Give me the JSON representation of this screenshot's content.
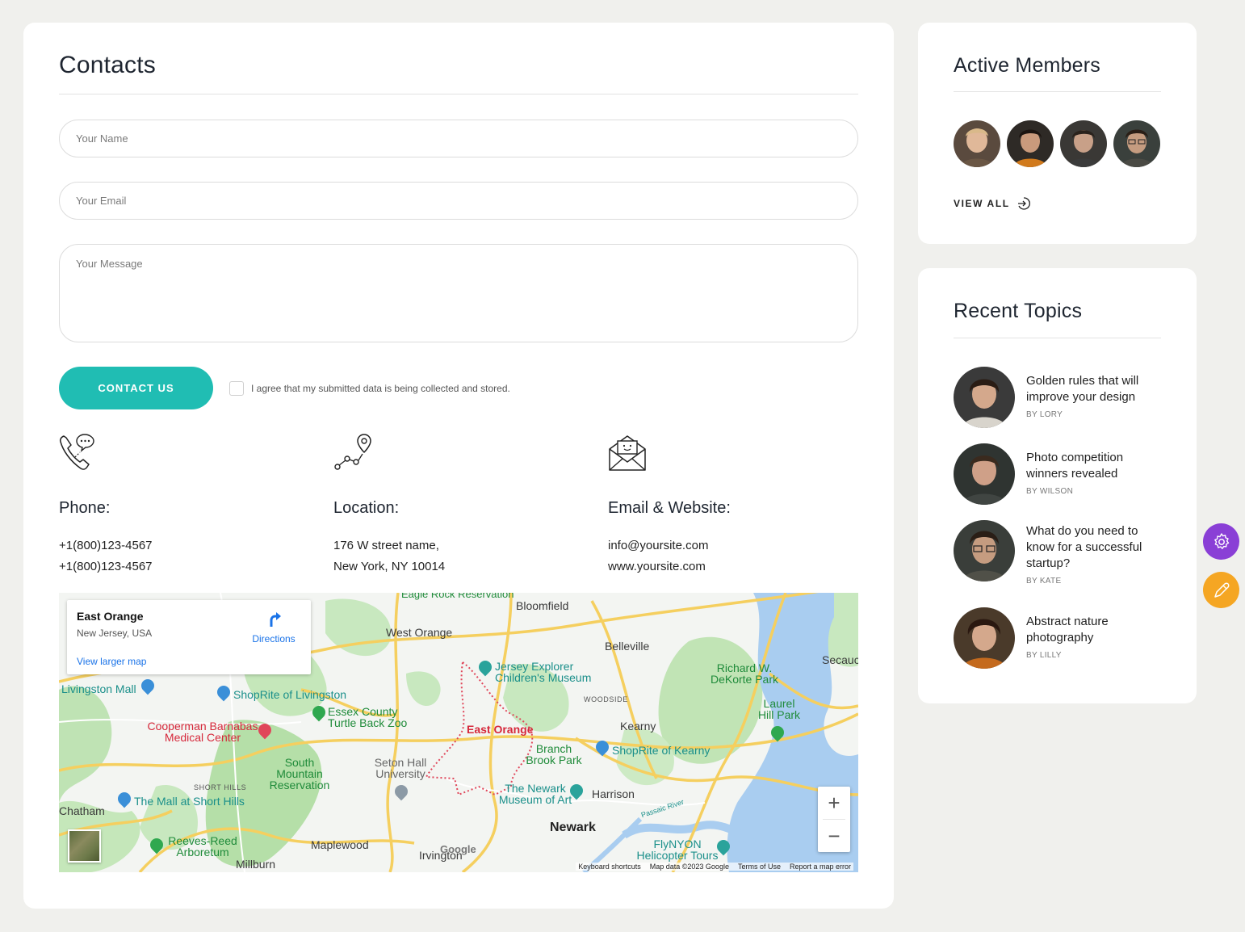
{
  "contacts": {
    "title": "Contacts",
    "form": {
      "name_placeholder": "Your Name",
      "email_placeholder": "Your Email",
      "message_placeholder": "Your Message",
      "submit_label": "CONTACT US",
      "agree_label": "I agree that my submitted data is being collected and stored."
    },
    "info": [
      {
        "title": "Phone:",
        "lines": [
          "+1(800)123-4567",
          "+1(800)123-4567"
        ],
        "icon": "phone-chat-icon"
      },
      {
        "title": "Location:",
        "lines": [
          "176 W street name,",
          "New York, NY 10014"
        ],
        "icon": "route-pin-icon"
      },
      {
        "title": "Email & Website:",
        "lines": [
          "info@yoursite.com",
          "www.yoursite.com"
        ],
        "icon": "envelope-open-icon"
      }
    ],
    "map": {
      "place": "East Orange",
      "address": "New Jersey, USA",
      "directions_label": "Directions",
      "larger_map_label": "View larger map",
      "labels": {
        "eagle_rock": "Eagle Rock Reservation",
        "bloomfield": "Bloomfield",
        "west_orange": "West Orange",
        "belleville": "Belleville",
        "secaucus": "Secauc",
        "livingston_mall": "Livingston Mall",
        "shoprite_livingston": "ShopRite of Livingston",
        "jersey_explorer": "Jersey Explorer Children's Museum",
        "richard_dekorte": "Richard W. DeKorte Park",
        "woodside": "WOODSIDE",
        "essex_zoo": "Essex County Turtle Back Zoo",
        "laurel_hill": "Laurel Hill Park",
        "cooperman": "Cooperman Barnabas Medical Center",
        "east_orange": "East Orange",
        "kearny": "Kearny",
        "branch_brook": "Branch Brook Park",
        "shoprite_kearny": "ShopRite of Kearny",
        "seton_hall": "Seton Hall University",
        "south_mountain": "South Mountain Reservation",
        "short_hills": "SHORT HILLS",
        "newark_museum": "The Newark Museum of Art",
        "harrison": "Harrison",
        "chatham": "Chatham",
        "mall_short_hills": "The Mall at Short Hills",
        "passaic_river": "Passaic River",
        "newark": "Newark",
        "reeves_reed": "Reeves-Reed Arboretum",
        "maplewood": "Maplewood",
        "irvington": "Irvington",
        "flynyon": "FlyNYON Helicopter Tours",
        "millburn": "Millburn"
      },
      "footer": [
        "Keyboard shortcuts",
        "Map data ©2023 Google",
        "Terms of Use",
        "Report a map error"
      ],
      "google": "Google",
      "zoom_in": "+",
      "zoom_out": "−"
    }
  },
  "members": {
    "title": "Active Members",
    "view_all_label": "VIEW ALL"
  },
  "topics": {
    "title": "Recent Topics",
    "items": [
      {
        "title": "Golden rules that will improve your design",
        "author": "BY LORY"
      },
      {
        "title": "Photo competition winners revealed",
        "author": "BY WILSON"
      },
      {
        "title": "What do you need to know for a successful startup?",
        "author": "BY KATE"
      },
      {
        "title": "Abstract nature photography",
        "author": "BY LILLY"
      }
    ]
  },
  "colors": {
    "accent": "#20bdb3",
    "gear_button": "#8a3fd6",
    "pen_button": "#f5a623"
  }
}
